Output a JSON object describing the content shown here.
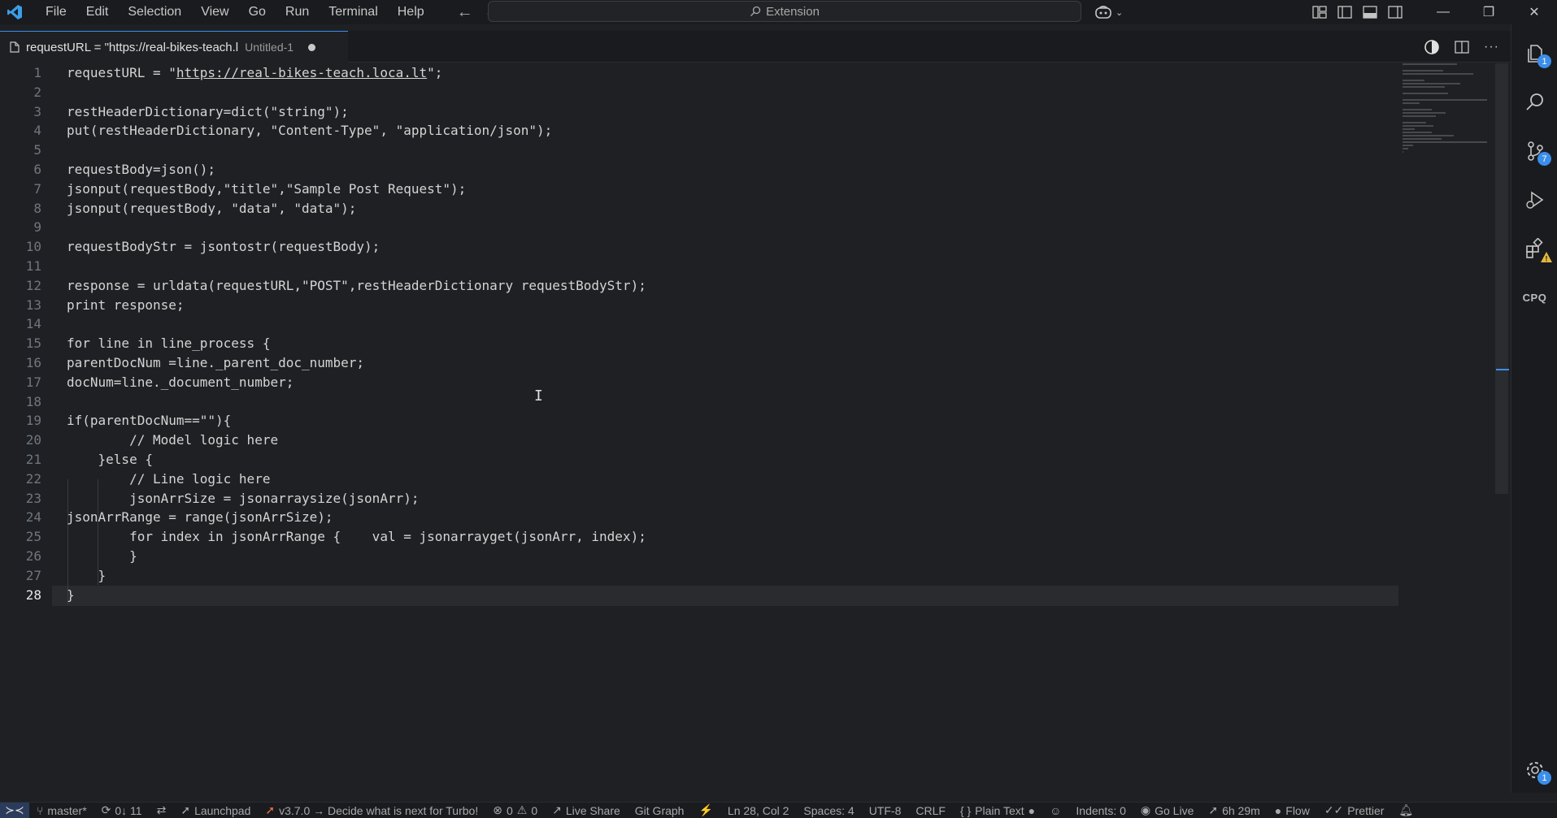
{
  "titlebar": {
    "menu": [
      "File",
      "Edit",
      "Selection",
      "View",
      "Go",
      "Run",
      "Terminal",
      "Help"
    ],
    "search_text": "Extension"
  },
  "tab": {
    "title": "requestURL = \"https://real-bikes-teach.l",
    "description": "Untitled-1"
  },
  "editor": {
    "lines": [
      "requestURL = \"https://real-bikes-teach.loca.lt\";",
      "",
      "restHeaderDictionary=dict(\"string\");",
      "put(restHeaderDictionary, \"Content-Type\", \"application/json\");",
      "",
      "requestBody=json();",
      "jsonput(requestBody,\"title\",\"Sample Post Request\");",
      "jsonput(requestBody, \"data\", \"data\");",
      "",
      "requestBodyStr = jsontostr(requestBody);",
      "",
      "response = urldata(requestURL,\"POST\",restHeaderDictionary requestBodyStr);",
      "print response;",
      "",
      "for line in line_process {",
      "parentDocNum =line._parent_doc_number;",
      "docNum=line._document_number;",
      "",
      "if(parentDocNum==\"\"){",
      "        // Model logic here",
      "    }else {",
      "        // Line logic here",
      "        jsonArrSize = jsonarraysize(jsonArr);",
      "jsonArrRange = range(jsonArrSize);",
      "        for index in jsonArrRange {    val = jsonarrayget(jsonArr, index);",
      "        }",
      "    }",
      "}"
    ],
    "active_line": 28
  },
  "activitybar": {
    "explorer_badge": "1",
    "scm_badge": "7",
    "cpq_label": "CPQ",
    "settings_badge": "1"
  },
  "statusbar": {
    "branch": "master*",
    "sync": "0↓ 11",
    "launchpad": "Launchpad",
    "turbo": "v3.7.0 → Decide what is next for Turbo!",
    "errors": "0",
    "warnings": "0",
    "live_share": "Live Share",
    "git_graph": "Git Graph",
    "position": "Ln 28, Col 2",
    "spaces": "Spaces: 4",
    "encoding": "UTF-8",
    "eol": "CRLF",
    "language": "Plain Text",
    "indents": "Indents: 0",
    "go_live": "Go Live",
    "timer": "6h 29m",
    "flow": "Flow",
    "prettier": "Prettier"
  }
}
